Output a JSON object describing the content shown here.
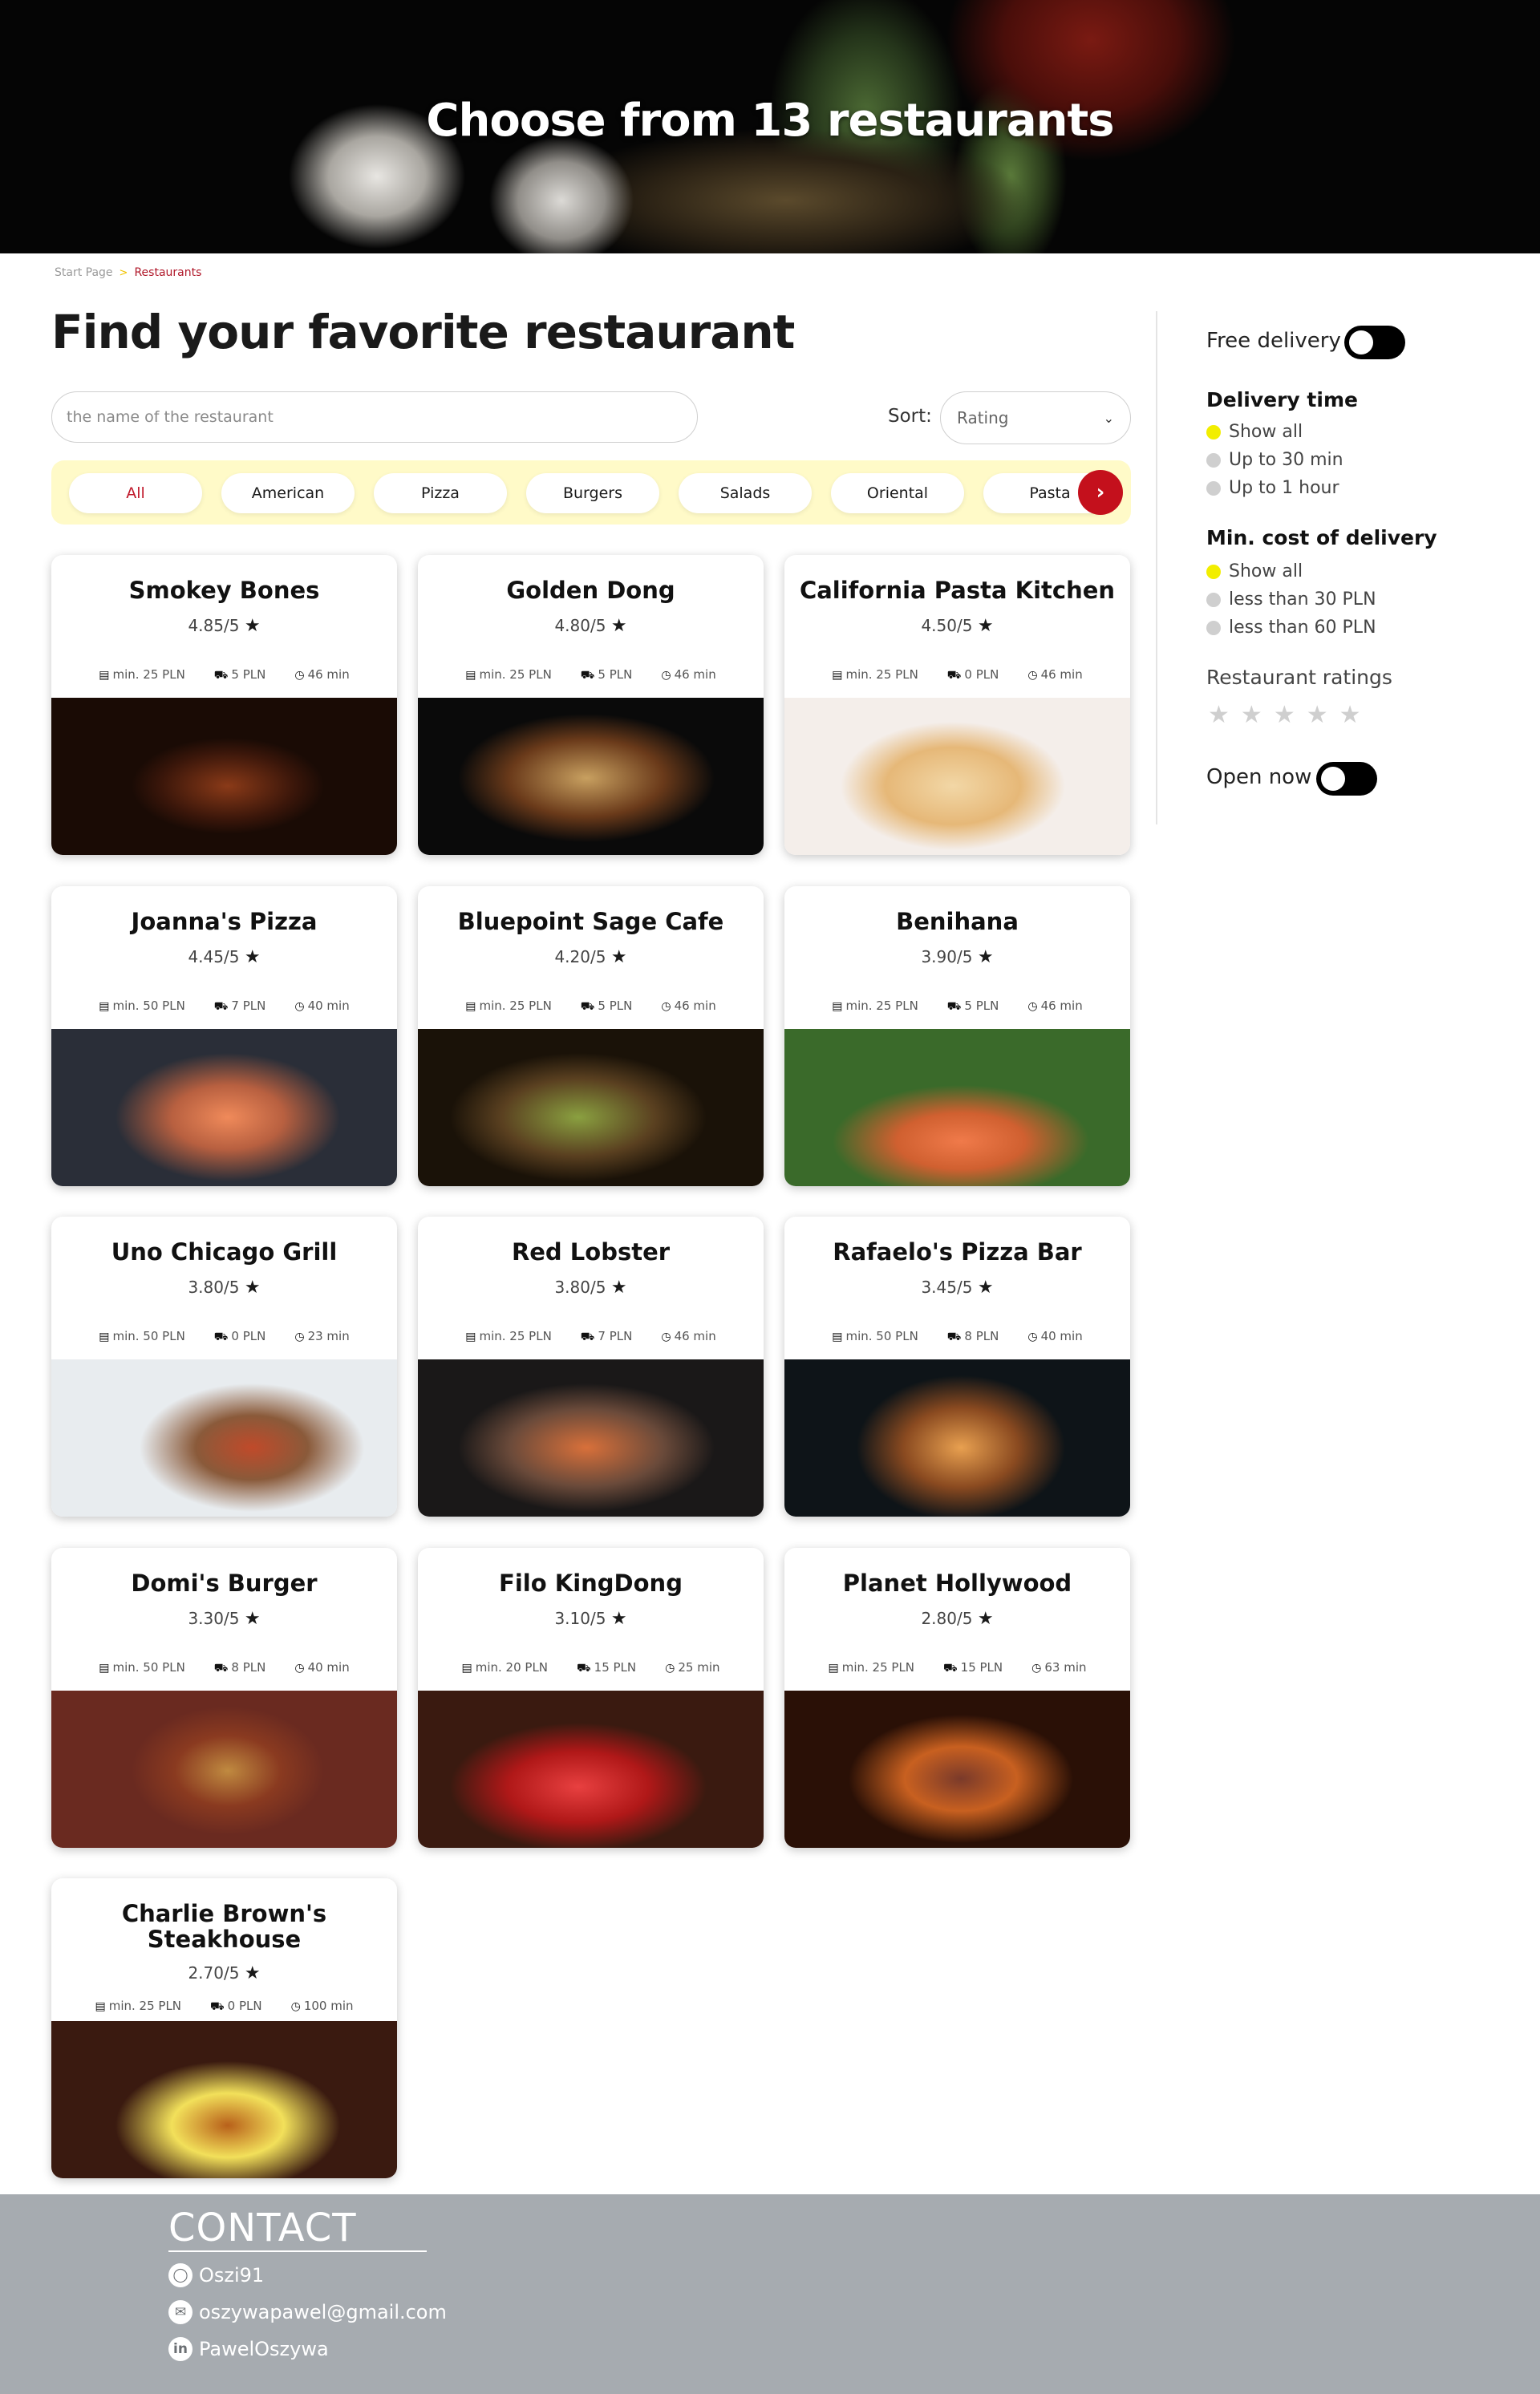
{
  "hero": {
    "title": "Choose from 13 restaurants"
  },
  "breadcrumb": {
    "start": "Start Page",
    "separator": ">",
    "current": "Restaurants"
  },
  "page_title": "Find your favorite restaurant",
  "search": {
    "placeholder": "the name of the restaurant"
  },
  "sort": {
    "label": "Sort:",
    "value": "Rating"
  },
  "categories": [
    "All",
    "American",
    "Pizza",
    "Burgers",
    "Salads",
    "Oriental",
    "Pasta"
  ],
  "restaurants": [
    {
      "name": "Smokey Bones",
      "rating": "4.85/5",
      "min": "min. 25 PLN",
      "delivery": "5 PLN",
      "time": "46 min"
    },
    {
      "name": "Golden Dong",
      "rating": "4.80/5",
      "min": "min. 25 PLN",
      "delivery": "5 PLN",
      "time": "46 min"
    },
    {
      "name": "California Pasta Kitchen",
      "rating": "4.50/5",
      "min": "min. 25 PLN",
      "delivery": "0 PLN",
      "time": "46 min"
    },
    {
      "name": "Joanna's Pizza",
      "rating": "4.45/5",
      "min": "min. 50 PLN",
      "delivery": "7 PLN",
      "time": "40 min"
    },
    {
      "name": "Bluepoint Sage Cafe",
      "rating": "4.20/5",
      "min": "min. 25 PLN",
      "delivery": "5 PLN",
      "time": "46 min"
    },
    {
      "name": "Benihana",
      "rating": "3.90/5",
      "min": "min. 25 PLN",
      "delivery": "5 PLN",
      "time": "46 min"
    },
    {
      "name": "Uno Chicago Grill",
      "rating": "3.80/5",
      "min": "min. 50 PLN",
      "delivery": "0 PLN",
      "time": "23 min"
    },
    {
      "name": "Red Lobster",
      "rating": "3.80/5",
      "min": "min. 25 PLN",
      "delivery": "7 PLN",
      "time": "46 min"
    },
    {
      "name": "Rafaelo's Pizza Bar",
      "rating": "3.45/5",
      "min": "min. 50 PLN",
      "delivery": "8 PLN",
      "time": "40 min"
    },
    {
      "name": "Domi's Burger",
      "rating": "3.30/5",
      "min": "min. 50 PLN",
      "delivery": "8 PLN",
      "time": "40 min"
    },
    {
      "name": "Filo KingDong",
      "rating": "3.10/5",
      "min": "min. 20 PLN",
      "delivery": "15 PLN",
      "time": "25 min"
    },
    {
      "name": "Planet Hollywood",
      "rating": "2.80/5",
      "min": "min. 25 PLN",
      "delivery": "15 PLN",
      "time": "63 min"
    },
    {
      "name": "Charlie Brown's Steakhouse",
      "rating": "2.70/5",
      "min": "min. 25 PLN",
      "delivery": "0 PLN",
      "time": "100 min"
    }
  ],
  "filters": {
    "free_delivery": "Free delivery",
    "delivery_time": {
      "title": "Delivery time",
      "options": [
        "Show all",
        "Up to 30 min",
        "Up to 1 hour"
      ],
      "selected": 0
    },
    "min_cost": {
      "title": "Min. cost of delivery",
      "options": [
        "Show all",
        "less than 30 PLN",
        "less than 60 PLN"
      ],
      "selected": 0
    },
    "ratings": {
      "title": "Restaurant ratings",
      "stars": 5,
      "selected": 0
    },
    "open_now": "Open now"
  },
  "contact": {
    "title": "CONTACT",
    "github": "Oszi91",
    "email": "oszywapawel@gmail.com",
    "linkedin": "PawelOszywa"
  },
  "colors": {
    "accent": "#c4101c",
    "category_bar": "#fffac8",
    "selected_dot": "#f2ee00",
    "footer": "#a6abb0"
  },
  "icons": {
    "min_order": "money-icon",
    "delivery": "truck-icon",
    "time": "clock-icon",
    "rating": "star-icon"
  }
}
